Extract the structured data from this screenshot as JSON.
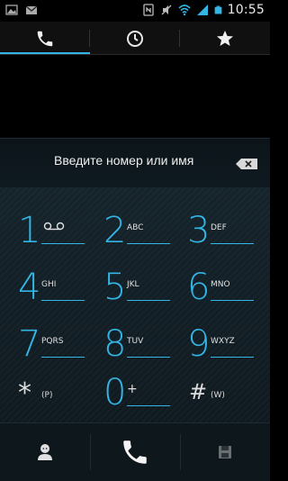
{
  "status_bar": {
    "time": "10:55",
    "icons": [
      "image-icon",
      "gmail-icon",
      "nfc-icon",
      "mute-icon",
      "wifi-icon",
      "signal-icon",
      "battery-icon"
    ]
  },
  "tabs": [
    {
      "name": "dialer",
      "icon": "phone-icon",
      "active": true
    },
    {
      "name": "call-log",
      "icon": "clock-icon",
      "active": false
    },
    {
      "name": "favorites",
      "icon": "star-icon",
      "active": false
    }
  ],
  "input": {
    "placeholder": "Введите номер или имя",
    "value": ""
  },
  "keypad": {
    "k1": {
      "digit": "1",
      "letters": ""
    },
    "k2": {
      "digit": "2",
      "letters": "ABC"
    },
    "k3": {
      "digit": "3",
      "letters": "DEF"
    },
    "k4": {
      "digit": "4",
      "letters": "GHI"
    },
    "k5": {
      "digit": "5",
      "letters": "JKL"
    },
    "k6": {
      "digit": "6",
      "letters": "MNO"
    },
    "k7": {
      "digit": "7",
      "letters": "PQRS"
    },
    "k8": {
      "digit": "8",
      "letters": "TUV"
    },
    "k9": {
      "digit": "9",
      "letters": "WXYZ"
    },
    "kstar": {
      "digit": "*",
      "letters": "(P)"
    },
    "k0": {
      "digit": "0",
      "letters": "+"
    },
    "khash": {
      "digit": "#",
      "letters": "(W)"
    }
  },
  "actions": [
    {
      "name": "contacts",
      "icon": "contact-icon"
    },
    {
      "name": "call",
      "icon": "phone-icon"
    },
    {
      "name": "save",
      "icon": "save-icon"
    }
  ],
  "colors": {
    "accent": "#33b5e5",
    "keypad_bg": "#15232b",
    "background": "#000000"
  }
}
